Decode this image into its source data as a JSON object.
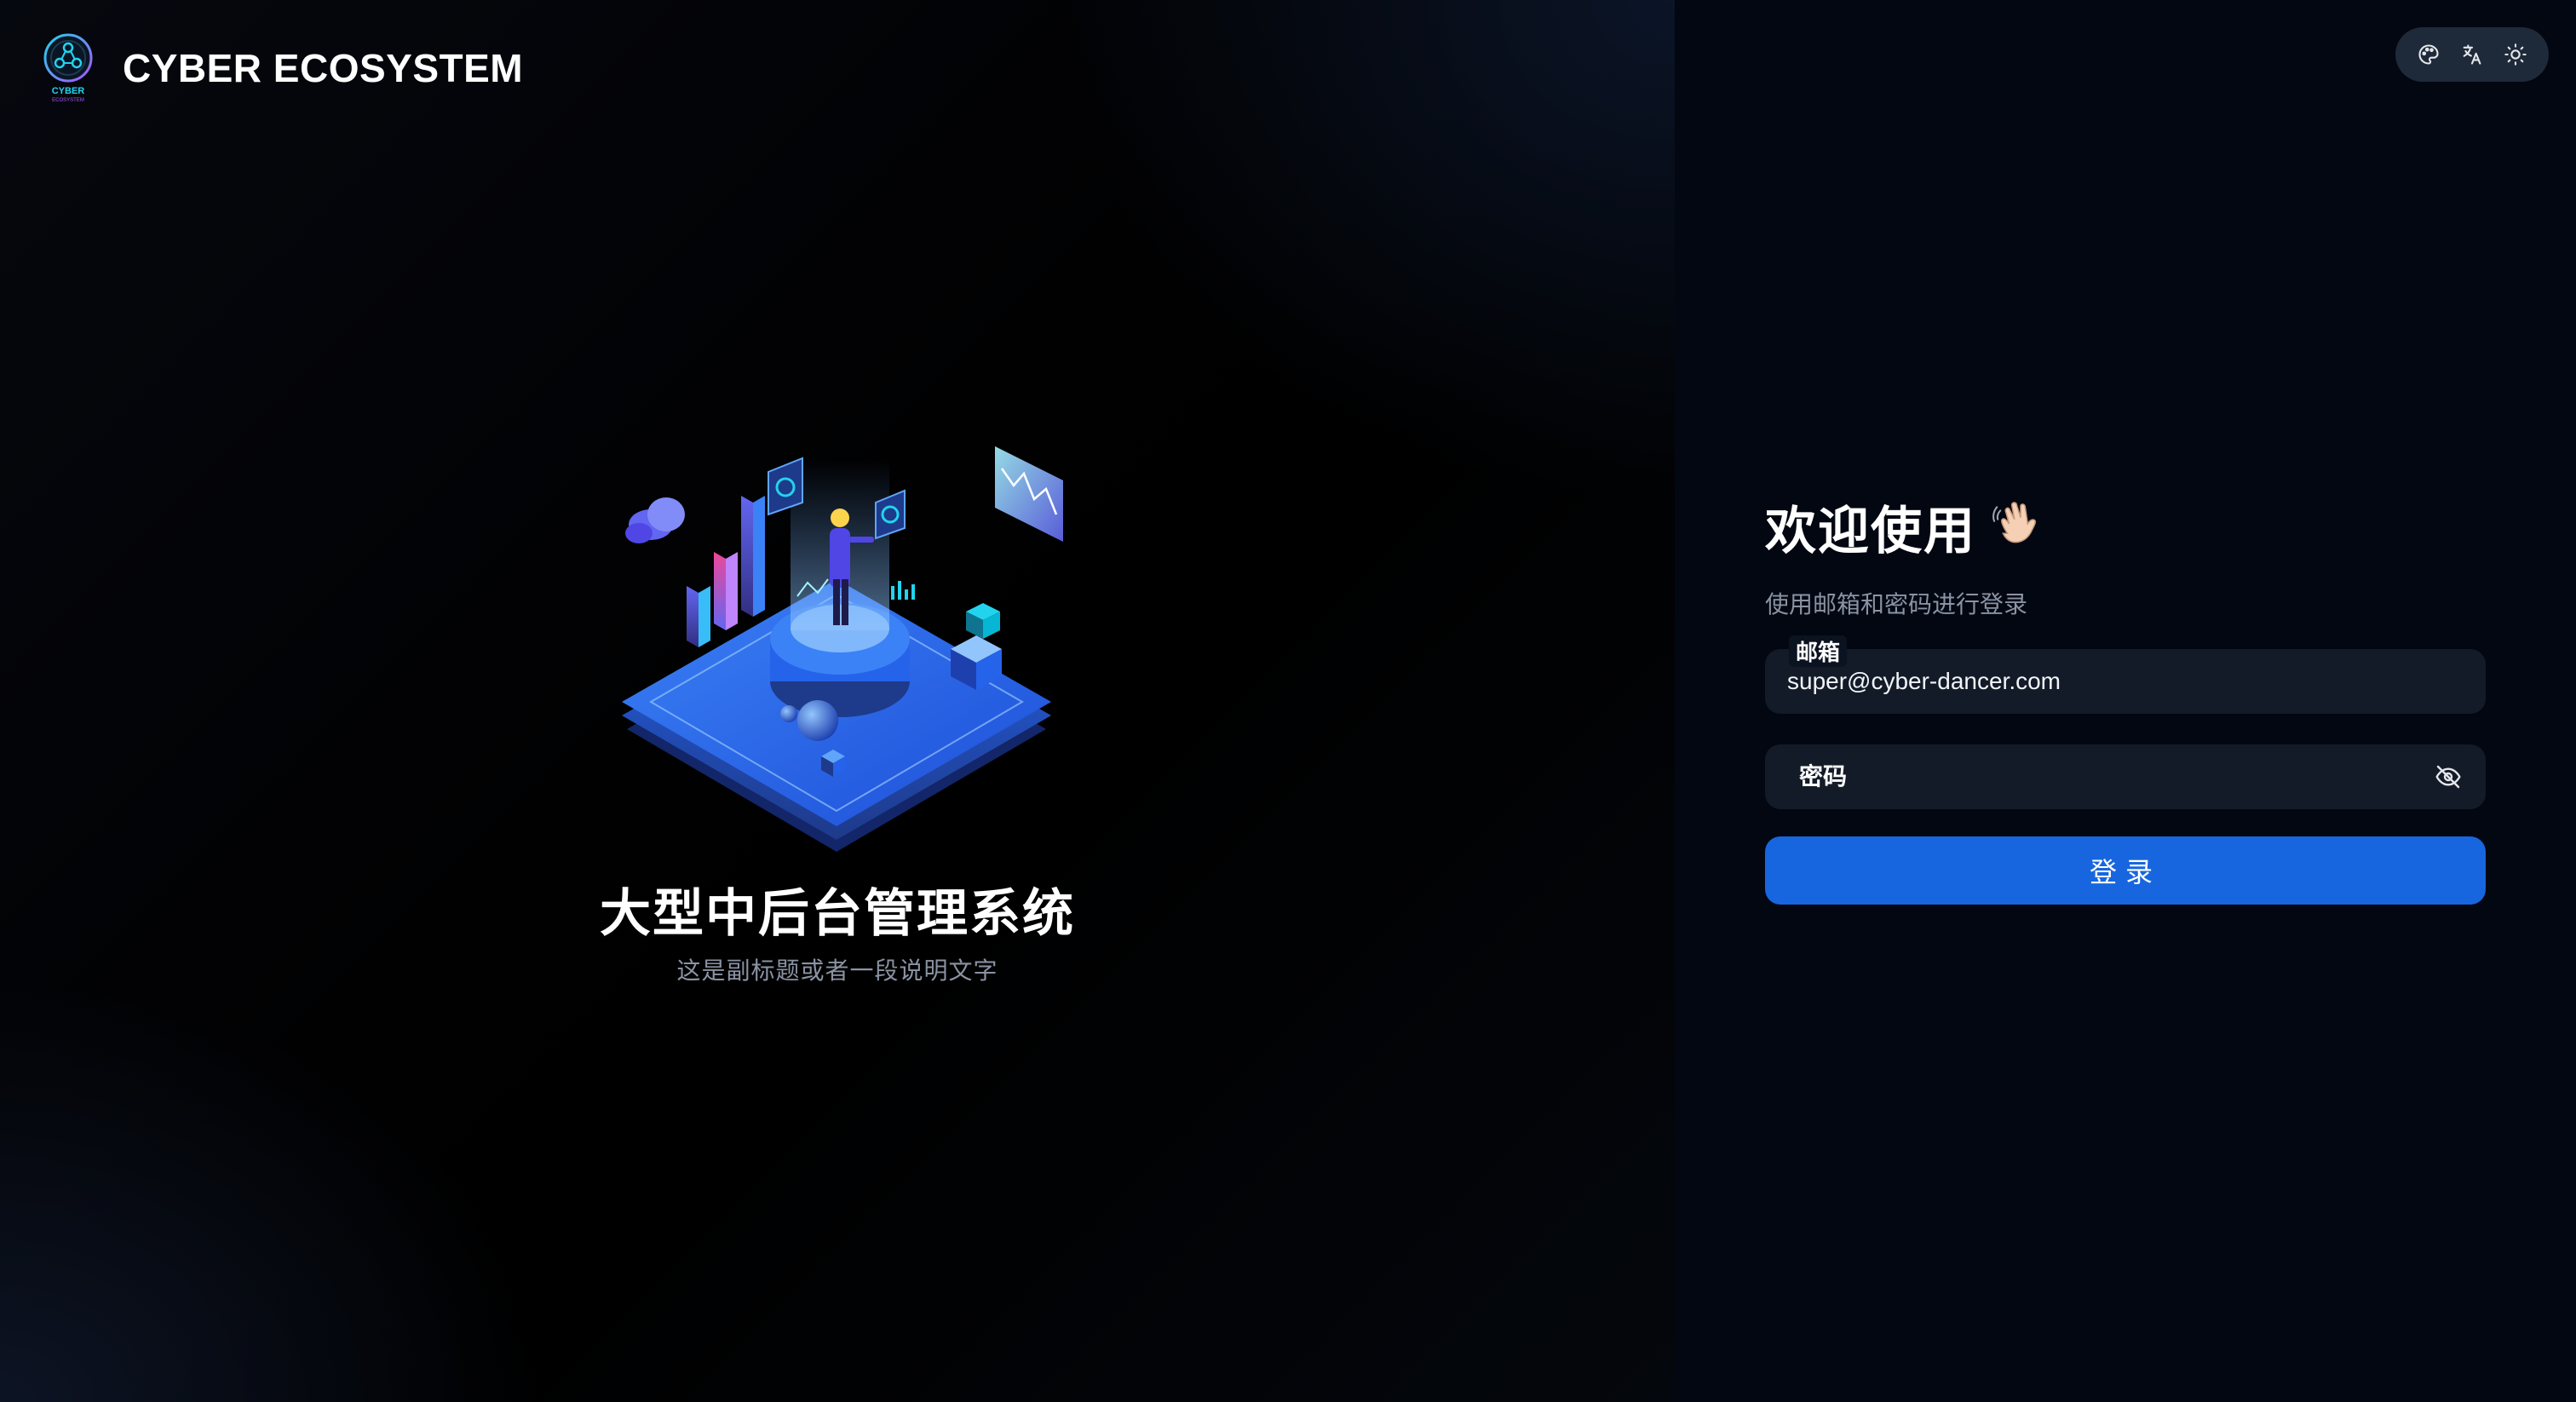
{
  "brand": {
    "title": "CYBER ECOSYSTEM",
    "logo_text_top": "CYBER",
    "logo_text_bottom": "ECOSYSTEM"
  },
  "toolbar": {
    "icons": [
      "palette-icon",
      "translate-icon",
      "sun-icon"
    ]
  },
  "hero": {
    "title": "大型中后台管理系统",
    "subtitle": "这是副标题或者一段说明文字"
  },
  "login": {
    "welcome_title": "欢迎使用",
    "welcome_emoji": "waving-hand-icon",
    "welcome_subtitle": "使用邮箱和密码进行登录",
    "email_label": "邮箱",
    "email_value": "super@cyber-dancer.com",
    "password_label": "密码",
    "password_value": "",
    "submit_label": "登录"
  },
  "colors": {
    "accent": "#1766df",
    "background": "#000000",
    "field_bg": "#141b28",
    "muted_text": "#8a93a3"
  }
}
